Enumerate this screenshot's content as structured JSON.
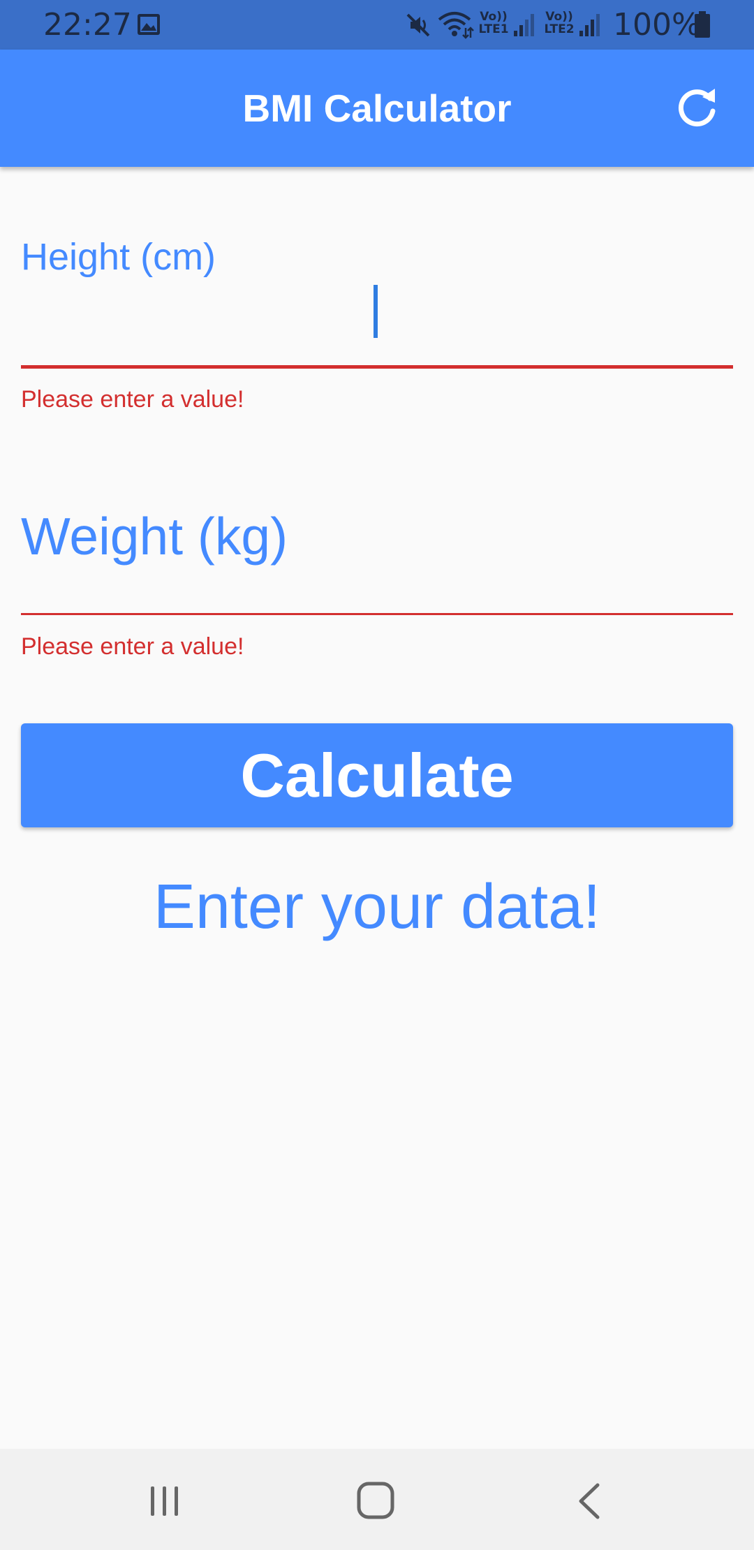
{
  "status_bar": {
    "time": "22:27",
    "lte1": "Vo)) LTE1",
    "lte2": "Vo)) LTE2",
    "battery": "100%",
    "icons": [
      "gallery-icon",
      "mute-icon",
      "wifi-icon",
      "signal-icon",
      "battery-icon"
    ]
  },
  "app_bar": {
    "title": "BMI Calculator",
    "action_icon": "refresh-icon",
    "color": "#448aff"
  },
  "form": {
    "height": {
      "label": "Height (cm)",
      "value": "",
      "error": "Please enter a value!"
    },
    "weight": {
      "label": "Weight (kg)",
      "value": "",
      "error": "Please enter a value!"
    },
    "error_color": "#d32f2f"
  },
  "calculate_button": {
    "label": "Calculate"
  },
  "result": {
    "text": "Enter your data!"
  },
  "nav_bar": {
    "icons": [
      "recents-icon",
      "home-icon",
      "back-icon"
    ]
  }
}
